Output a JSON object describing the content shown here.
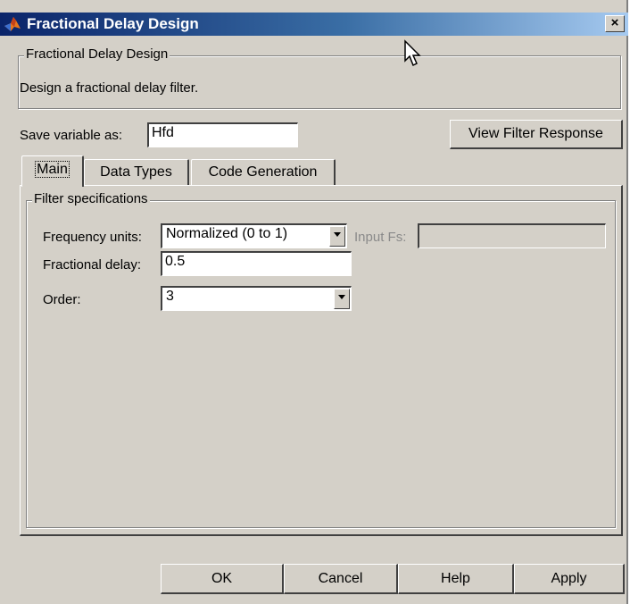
{
  "window": {
    "title": "Fractional Delay Design",
    "close_label": "×",
    "icon": "matlab-logo-icon"
  },
  "description_group": {
    "legend": "Fractional Delay Design",
    "text": "Design a fractional delay filter."
  },
  "save_variable": {
    "label": "Save variable as:",
    "value": "Hfd"
  },
  "view_filter_response_button": "View Filter Response",
  "tabs": [
    {
      "label": "Main",
      "active": true
    },
    {
      "label": "Data Types",
      "active": false
    },
    {
      "label": "Code Generation",
      "active": false
    }
  ],
  "filter_specs": {
    "legend": "Filter specifications",
    "frequency_units": {
      "label": "Frequency units:",
      "selected": "Normalized (0 to 1)"
    },
    "input_fs": {
      "label": "Input Fs:",
      "value": "",
      "enabled": false
    },
    "fractional_delay": {
      "label": "Fractional delay:",
      "value": "0.5"
    },
    "order": {
      "label": "Order:",
      "selected": "3"
    }
  },
  "buttons": {
    "ok": "OK",
    "cancel": "Cancel",
    "help": "Help",
    "apply": "Apply"
  },
  "colors": {
    "window_bg": "#d4d0c8",
    "titlebar_start": "#0a246a",
    "titlebar_end": "#a6caf0",
    "disabled_text": "#8a8a8a"
  }
}
